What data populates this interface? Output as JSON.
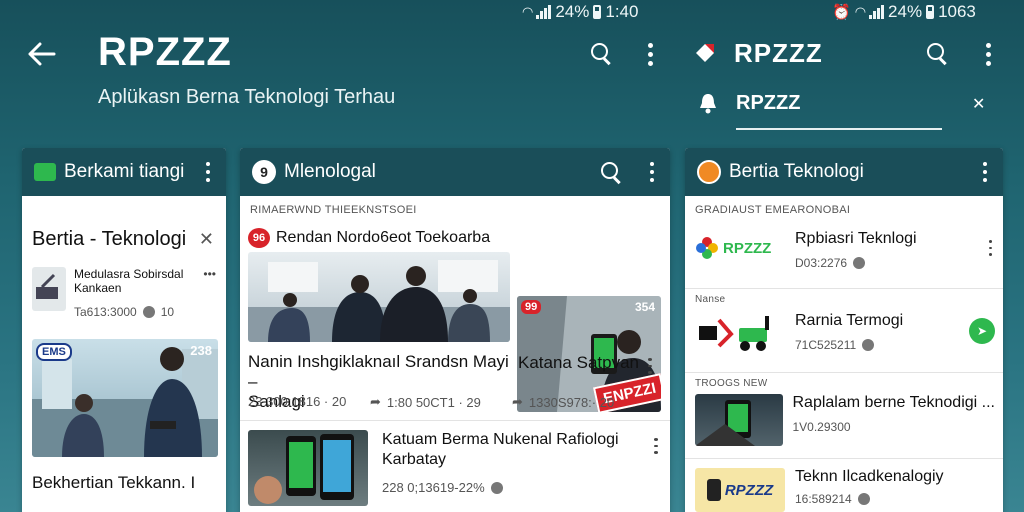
{
  "status_left": {
    "signal": "all",
    "battery_pct": "24%",
    "time": "1:40"
  },
  "status_right": {
    "left_glyph": "ID",
    "signal": "dll",
    "battery_pct": "24%",
    "time": "1063"
  },
  "appbar": {
    "title": "RPZZZ",
    "subtitle": "Aplükasn Berna Teknologi Terhau"
  },
  "right_header": {
    "title": "RPZZZ",
    "tab_label": "RPZZZ"
  },
  "card1": {
    "header_title": "Berkami tiangi",
    "popup_title": "Bertia - Teknologi",
    "item1": {
      "title": "Medulasra Sobirsdal\nKankaen",
      "meta": "Ta613:3000",
      "meta_tail": "10"
    },
    "hero_badge_left": "EMS",
    "hero_badge_right": "238",
    "bottom_title": "Bekhertian Tekkann.  I"
  },
  "card2": {
    "header_title": "Mlenologal",
    "header_icon": "9",
    "section_label": "RIMAERWND THIEEKNSTSOEI",
    "featured_badge": "96",
    "featured_title": "Rendan Nordo6eot Toekoarba",
    "hero_title": "Nanin Inshgiklaknaıl Srandsn Mayi –\nSanlagi",
    "hero_meta1": "23 300:1816 · 20",
    "hero_meta2": "1:80 50CT1 · 29",
    "side_title": "Katana Satpvan",
    "side_badge_left": "99",
    "side_badge_right": "354",
    "side_banner": "ENPZZI",
    "side_meta": "1330S978:· 20",
    "item2_title": "Katuam Berma Nukenal Rafiologi\nKarbatay",
    "item2_meta": "228 0;13619-22%"
  },
  "card3": {
    "header_title": "Bertia Teknologi",
    "section_label": "GRADIAUST EMEARONOBAI",
    "rows": [
      {
        "logo": "RPZZZ",
        "title": "Rpbiasri Teknlogi",
        "meta": "D03:2276"
      },
      {
        "logo": "",
        "title": "Rarnia Termogi",
        "meta": "71C525211",
        "label_above": "Nanse"
      },
      {
        "logo": "",
        "title": "Raplalam berne Teknodigi ...",
        "meta": "1V0.29300",
        "label_above": "TROOGS NEW"
      },
      {
        "logo": "RPZZZ",
        "title": "Teknn Ilcadkenalogiy",
        "meta": "16:589214"
      }
    ]
  },
  "colors": {
    "teal_header": "#1a4e59",
    "accent_green": "#2eb84e",
    "badge_red": "#d8232a"
  }
}
